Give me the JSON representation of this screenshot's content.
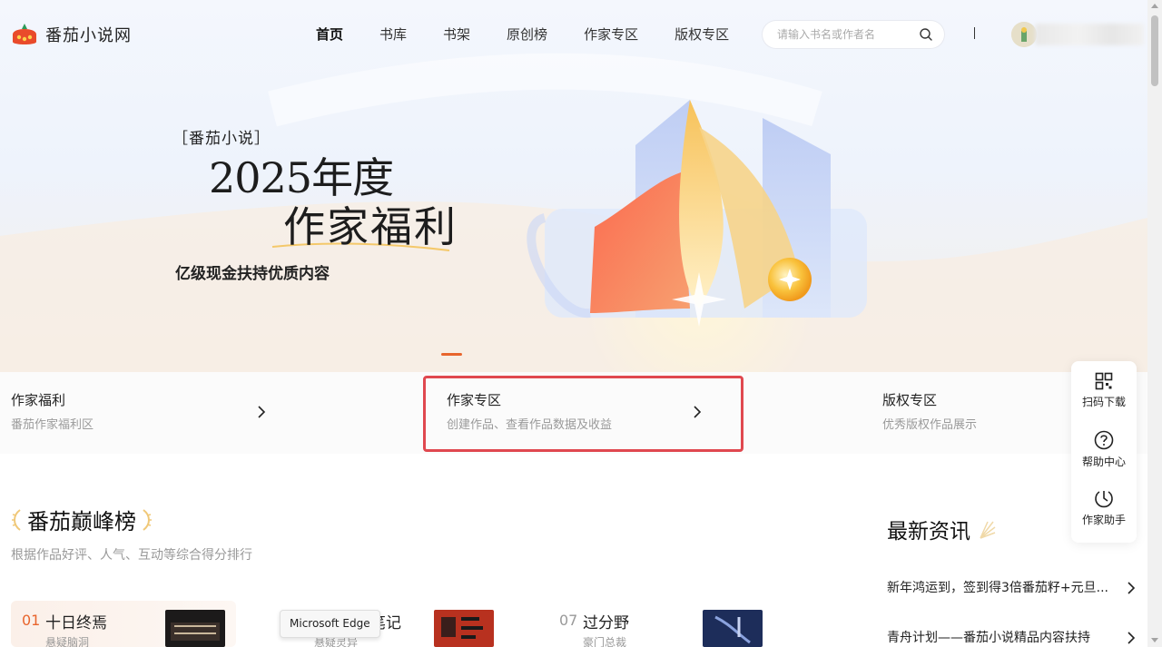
{
  "header": {
    "logo_text": "番茄小说网",
    "nav": [
      {
        "label": "首页",
        "active": true
      },
      {
        "label": "书库"
      },
      {
        "label": "书架"
      },
      {
        "label": "原创榜"
      },
      {
        "label": "作家专区"
      },
      {
        "label": "版权专区"
      }
    ],
    "search_placeholder": "请输入书名或作者名",
    "search_icon": "search-icon"
  },
  "banner": {
    "brand": "［番茄小说］",
    "year_line": "2025年度",
    "welfare_line": "作家福利",
    "subtitle": "亿级现金扶持优质内容",
    "accent_color": "#e8652d"
  },
  "features": [
    {
      "title": "作家福利",
      "desc": "番茄作家福利区"
    },
    {
      "title": "作家专区",
      "desc": "创建作品、查看作品数据及收益"
    },
    {
      "title": "版权专区",
      "desc": "优秀版权作品展示"
    }
  ],
  "highlight_color": "#e0484f",
  "ranking": {
    "title": "番茄巅峰榜",
    "subtitle": "根据作品好评、人气、互动等综合得分排行",
    "items": [
      {
        "num": "01",
        "name": "十日终焉",
        "genre": "悬疑脑洞"
      },
      {
        "num": "",
        "name": "笔记",
        "genre": "悬疑灵异"
      },
      {
        "num": "07",
        "name": "过分野",
        "genre": "豪门总裁"
      }
    ]
  },
  "tooltip": "Microsoft Edge",
  "news": {
    "title": "最新资讯",
    "items": [
      {
        "text": "新年鸿运到，签到得3倍番茄籽+元旦..."
      },
      {
        "text": "青舟计划——番茄小说精品内容扶持"
      }
    ]
  },
  "float_bar": [
    {
      "label": "扫码下载",
      "icon": "qr-code-icon"
    },
    {
      "label": "帮助中心",
      "icon": "help-icon"
    },
    {
      "label": "作家助手",
      "icon": "assistant-icon"
    }
  ]
}
